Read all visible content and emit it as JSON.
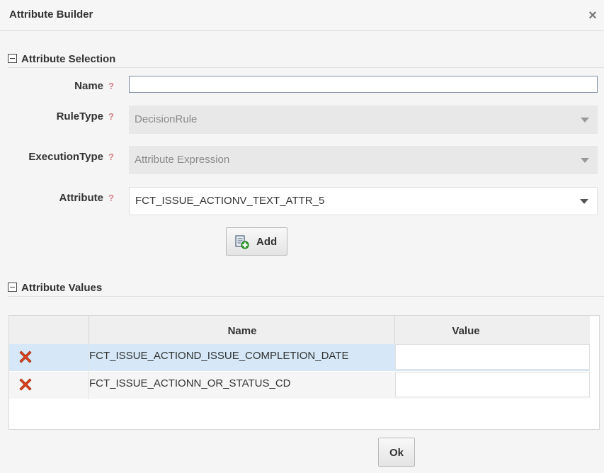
{
  "dialog": {
    "title": "Attribute Builder",
    "close_glyph": "×"
  },
  "attribute_selection": {
    "heading": "Attribute Selection",
    "help_glyph": "?",
    "name": {
      "label": "Name",
      "value": "",
      "placeholder": ""
    },
    "rule_type": {
      "label": "RuleType",
      "value": "DecisionRule",
      "disabled": true
    },
    "execution_type": {
      "label": "ExecutionType",
      "value": "Attribute Expression",
      "disabled": true
    },
    "attribute": {
      "label": "Attribute",
      "value": "FCT_ISSUE_ACTIONV_TEXT_ATTR_5"
    },
    "add_button": {
      "label": "Add",
      "icon": "add-document-icon"
    }
  },
  "attribute_values": {
    "heading": "Attribute Values",
    "columns": [
      "",
      "Name",
      "Value"
    ],
    "rows": [
      {
        "name": "FCT_ISSUE_ACTIOND_ISSUE_COMPLETION_DATE",
        "value": "",
        "selected": true
      },
      {
        "name": "FCT_ISSUE_ACTIONN_OR_STATUS_CD",
        "value": "",
        "selected": false
      }
    ],
    "delete_icon": "delete-x-icon"
  },
  "footer": {
    "ok_label": "Ok"
  },
  "colors": {
    "selected_row": "#d6e8f7",
    "help": "#d4818a",
    "delete": "#e0421b"
  }
}
